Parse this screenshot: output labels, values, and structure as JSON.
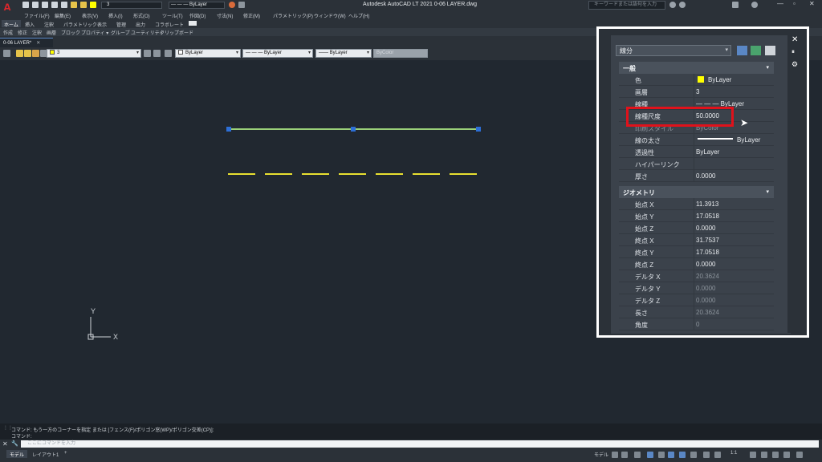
{
  "window": {
    "title": "Autodesk AutoCAD LT 2021   0-06 LAYER.dwg",
    "search_placeholder": "キーワードまたは語句を入力"
  },
  "quick_access": {
    "layer_value": "3",
    "linetype_value": "— — — ByLayer"
  },
  "menu": [
    "ファイル(F)",
    "編集(E)",
    "表示(V)",
    "挿入(I)",
    "形式(O)",
    "ツール(T)",
    "作図(D)",
    "寸法(N)",
    "修正(M)",
    "パラメトリック(P)",
    "ウィンドウ(W)",
    "ヘルプ(H)"
  ],
  "ribbon_tabs": [
    "ホーム",
    "挿入",
    "注釈",
    "パラメトリック",
    "表示",
    "管理",
    "出力",
    "コラボレート"
  ],
  "ribbon_panels": [
    "作成",
    "修正",
    "注釈",
    "画層",
    "ブロック",
    "プロパティ ▾",
    "グループ",
    "ユーティリティ",
    "クリップボード"
  ],
  "file_tab": "0-06 LAYER*",
  "prop_toolbar": {
    "layer": "3",
    "color": "ByLayer",
    "linetype": "— — — ByLayer",
    "lineweight": "—— ByLayer",
    "plotstyle": "ByColor"
  },
  "ucs": {
    "y": "Y",
    "x": "X"
  },
  "palette": {
    "object_type": "線分",
    "sections": {
      "general": "一般",
      "geometry": "ジオメトリ"
    },
    "general_rows": [
      {
        "name": "色",
        "value": "ByLayer"
      },
      {
        "name": "画層",
        "value": "3"
      },
      {
        "name": "線種",
        "value": "— — — ByLayer"
      },
      {
        "name": "線種尺度",
        "value": "50.0000"
      },
      {
        "name": "印刷スタイル",
        "value": "ByColor"
      },
      {
        "name": "線の太さ",
        "value": "ByLayer"
      },
      {
        "name": "透過性",
        "value": "ByLayer"
      },
      {
        "name": "ハイパーリンク",
        "value": ""
      },
      {
        "name": "厚さ",
        "value": "0.0000"
      }
    ],
    "geometry_rows": [
      {
        "name": "始点 X",
        "value": "11.3913"
      },
      {
        "name": "始点 Y",
        "value": "17.0518"
      },
      {
        "name": "始点 Z",
        "value": "0.0000"
      },
      {
        "name": "終点 X",
        "value": "31.7537"
      },
      {
        "name": "終点 Y",
        "value": "17.0518"
      },
      {
        "name": "終点 Z",
        "value": "0.0000"
      },
      {
        "name": "デルタ X",
        "value": "20.3624"
      },
      {
        "name": "デルタ Y",
        "value": "0.0000"
      },
      {
        "name": "デルタ Z",
        "value": "0.0000"
      },
      {
        "name": "長さ",
        "value": "20.3624"
      },
      {
        "name": "角度",
        "value": "0"
      }
    ]
  },
  "command": {
    "history_1": "コマンド: もう一方のコーナーを指定 または [フェンス(F)/ポリゴン窓(WP)/ポリゴン交差(CP)]:",
    "history_2": "コマンド:",
    "input_placeholder": "ここにコマンドを入力"
  },
  "status": {
    "tab_model": "モデル",
    "tab_layout": "レイアウト1",
    "scale": "1:1"
  },
  "colors": {
    "selected_line": "#9bd17a",
    "grip": "#2d6fd6",
    "dashed_line": "#e8e030",
    "highlight": "#e0121b",
    "layer_swatch": "#ffff00"
  }
}
